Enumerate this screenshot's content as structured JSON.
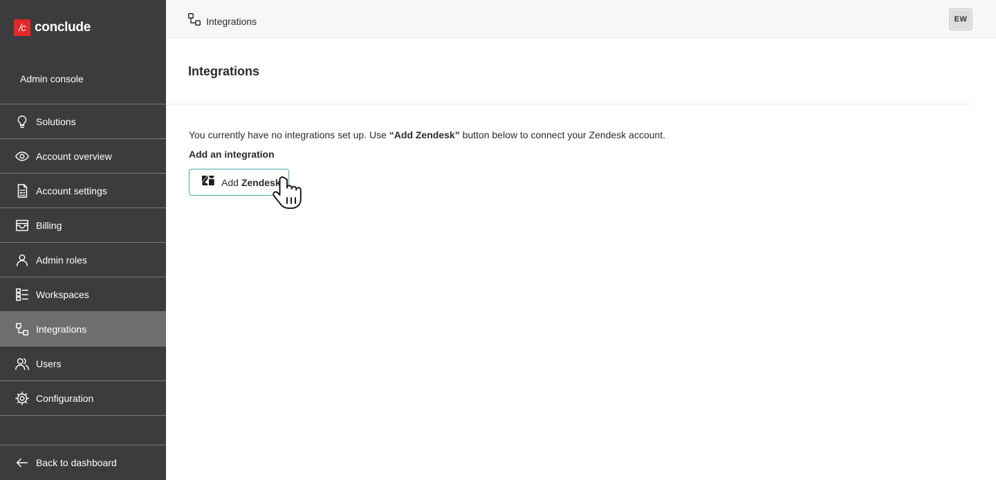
{
  "brand": {
    "mark": "/c",
    "name": "conclude",
    "accent": "#e52727"
  },
  "sidebar": {
    "console_label": "Admin console",
    "items": [
      {
        "label": "Solutions",
        "icon": "lightbulb-icon",
        "active": false
      },
      {
        "label": "Account overview",
        "icon": "eye-icon",
        "active": false
      },
      {
        "label": "Account settings",
        "icon": "document-settings-icon",
        "active": false
      },
      {
        "label": "Billing",
        "icon": "billing-icon",
        "active": false
      },
      {
        "label": "Admin roles",
        "icon": "person-icon",
        "active": false
      },
      {
        "label": "Workspaces",
        "icon": "workspaces-icon",
        "active": false
      },
      {
        "label": "Integrations",
        "icon": "integrations-icon",
        "active": true
      },
      {
        "label": "Users",
        "icon": "users-icon",
        "active": false
      },
      {
        "label": "Configuration",
        "icon": "gear-icon",
        "active": false
      }
    ],
    "back_label": "Back to dashboard"
  },
  "header": {
    "breadcrumb": "Integrations",
    "avatar_initials": "EW"
  },
  "main": {
    "title": "Integrations",
    "info_prefix": "You currently have no integrations set up. Use ",
    "info_bold": "“Add Zendesk”",
    "info_suffix": " button below to connect your Zendesk account.",
    "subheading": "Add an integration",
    "add_button": {
      "prefix": "Add ",
      "bold": "Zendesk",
      "icon": "zendesk-icon"
    }
  },
  "colors": {
    "sidebar_bg": "#3c3c3c",
    "active_item_bg": "#6e6e6e",
    "button_border": "#4aa8a4"
  }
}
